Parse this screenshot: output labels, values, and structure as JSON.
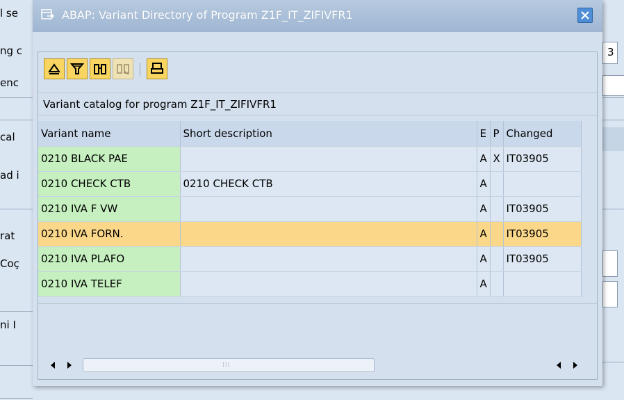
{
  "background": {
    "labels": [
      "l se",
      "ng c",
      "enc",
      "cal",
      "ad i",
      "rat",
      "Coç",
      "ni I"
    ],
    "right_value": "3"
  },
  "dialog": {
    "title": "ABAP: Variant Directory of Program Z1F_IT_ZIFIVFR1",
    "title_icon": "popup-window-icon",
    "close_icon": "close-icon",
    "toolbar": {
      "buttons": [
        {
          "icon": "details-icon"
        },
        {
          "icon": "filter-icon"
        },
        {
          "icon": "find-icon"
        },
        {
          "icon": "find-next-icon",
          "disabled": true
        },
        {
          "icon": "print-icon"
        }
      ]
    },
    "catalog_title": "Variant catalog for program Z1F_IT_ZIFIVFR1",
    "columns": [
      "Variant name",
      "Short description",
      "E",
      "P",
      "Changed"
    ],
    "rows": [
      [
        "0210 BLACK PAE",
        "",
        "A",
        "X",
        "IT03905"
      ],
      [
        "0210 CHECK CTB",
        "0210 CHECK CTB",
        "A",
        "",
        ""
      ],
      [
        "0210 IVA F VW",
        "",
        "A",
        "",
        "IT03905"
      ],
      [
        "0210 IVA FORN.",
        "",
        "A",
        "",
        "IT03905"
      ],
      [
        "0210 IVA PLAFO",
        "",
        "A",
        "",
        "IT03905"
      ],
      [
        "0210 IVA TELEF",
        "",
        "A",
        "",
        ""
      ]
    ],
    "selected_row": 3,
    "colors": {
      "key_cell": "#c6f0c0",
      "selected_row": "#fbd78a",
      "cell": "#dce7f3",
      "header": "#c9d8ea"
    }
  }
}
